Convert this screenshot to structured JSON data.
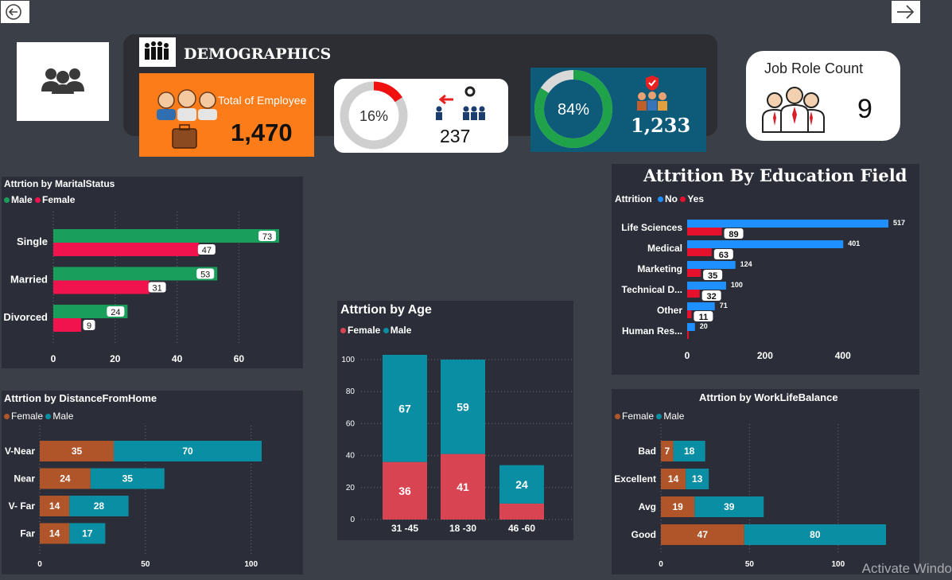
{
  "header": {
    "title": "DEMOGRAPHICS"
  },
  "kpis": {
    "total": {
      "label": "Total of Employee",
      "value": "1,470"
    },
    "attrition": {
      "percent": "16%",
      "percent_fraction": 0.16,
      "value": "237"
    },
    "retained": {
      "percent": "84%",
      "percent_fraction": 0.84,
      "value": "1,233"
    },
    "jobrole": {
      "label": "Job Role Count",
      "value": "9"
    }
  },
  "colors": {
    "male_green": "#1a9e5c",
    "female_pink": "#f0134d",
    "no_blue": "#1e90ff",
    "yes_red": "#e8112d",
    "age_female": "#d94452",
    "age_male": "#0a8ea3",
    "dist_female": "#b0552a",
    "dist_male": "#0a8ea3",
    "orange": "#fb7c18",
    "teal_card": "#0e5a79"
  },
  "watermark": "Activate Windo",
  "chart_data": [
    {
      "id": "marital",
      "type": "bar",
      "orientation": "horizontal",
      "title": "Attrtion by MaritalStatus",
      "legend_order": [
        "Male",
        "Female"
      ],
      "categories": [
        "Single",
        "Married",
        "Divorced"
      ],
      "series": [
        {
          "name": "Male",
          "values": [
            73,
            53,
            24
          ],
          "color": "#1a9e5c"
        },
        {
          "name": "Female",
          "values": [
            47,
            31,
            9
          ],
          "color": "#f0134d"
        }
      ],
      "xlim": [
        0,
        73
      ],
      "ticks": [
        0,
        20,
        40,
        60
      ],
      "grid": true
    },
    {
      "id": "education",
      "type": "bar",
      "orientation": "horizontal",
      "title": "Attrition By Education Field",
      "legend_title": "Attrition",
      "legend_order": [
        "No",
        "Yes"
      ],
      "categories": [
        "Life Sciences",
        "Medical",
        "Marketing",
        "Technical D...",
        "Other",
        "Human Res..."
      ],
      "series": [
        {
          "name": "No",
          "values": [
            517,
            401,
            124,
            100,
            71,
            20
          ],
          "color": "#1e90ff"
        },
        {
          "name": "Yes",
          "values": [
            89,
            63,
            35,
            32,
            11,
            3
          ],
          "color": "#e8112d"
        }
      ],
      "xlim": [
        0,
        517
      ],
      "ticks": [
        0,
        200,
        400
      ],
      "grid": false
    },
    {
      "id": "age",
      "type": "bar",
      "orientation": "vertical",
      "stacked": true,
      "title": "Attrtion by Age",
      "legend_order": [
        "Female",
        "Male"
      ],
      "categories": [
        "31 -45",
        "18 -30",
        "46 -60"
      ],
      "series": [
        {
          "name": "Female",
          "values": [
            36,
            41,
            10
          ],
          "labels": [
            "36",
            "41",
            ""
          ],
          "color": "#d94452"
        },
        {
          "name": "Male",
          "values": [
            67,
            59,
            24
          ],
          "labels": [
            "67",
            "59",
            "24"
          ],
          "color": "#0a8ea3"
        }
      ],
      "ylim": [
        0,
        100
      ],
      "ticks": [
        0,
        20,
        40,
        60,
        80,
        100
      ],
      "grid": true
    },
    {
      "id": "distance",
      "type": "bar",
      "orientation": "horizontal",
      "stacked": true,
      "title": "Attrtion by DistanceFromHome",
      "legend_order": [
        "Female",
        "Male"
      ],
      "categories": [
        "V-Near",
        "Near",
        "V- Far",
        "Far"
      ],
      "series": [
        {
          "name": "Female",
          "values": [
            35,
            24,
            14,
            14
          ],
          "color": "#b0552a"
        },
        {
          "name": "Male",
          "values": [
            70,
            35,
            28,
            17
          ],
          "color": "#0a8ea3"
        }
      ],
      "xlim": [
        0,
        105
      ],
      "ticks": [
        0,
        50,
        100
      ],
      "grid": true
    },
    {
      "id": "worklife",
      "type": "bar",
      "orientation": "horizontal",
      "stacked": true,
      "title": "Attrtion by WorkLifeBalance",
      "legend_order": [
        "Female",
        "Male"
      ],
      "categories": [
        "Bad",
        "Excellent",
        "Avg",
        "Good"
      ],
      "series": [
        {
          "name": "Female",
          "values": [
            7,
            14,
            19,
            47
          ],
          "color": "#b0552a"
        },
        {
          "name": "Male",
          "values": [
            18,
            13,
            39,
            80
          ],
          "color": "#0a8ea3"
        }
      ],
      "xlim": [
        0,
        127
      ],
      "ticks": [
        0,
        50,
        100
      ],
      "grid": true
    }
  ]
}
